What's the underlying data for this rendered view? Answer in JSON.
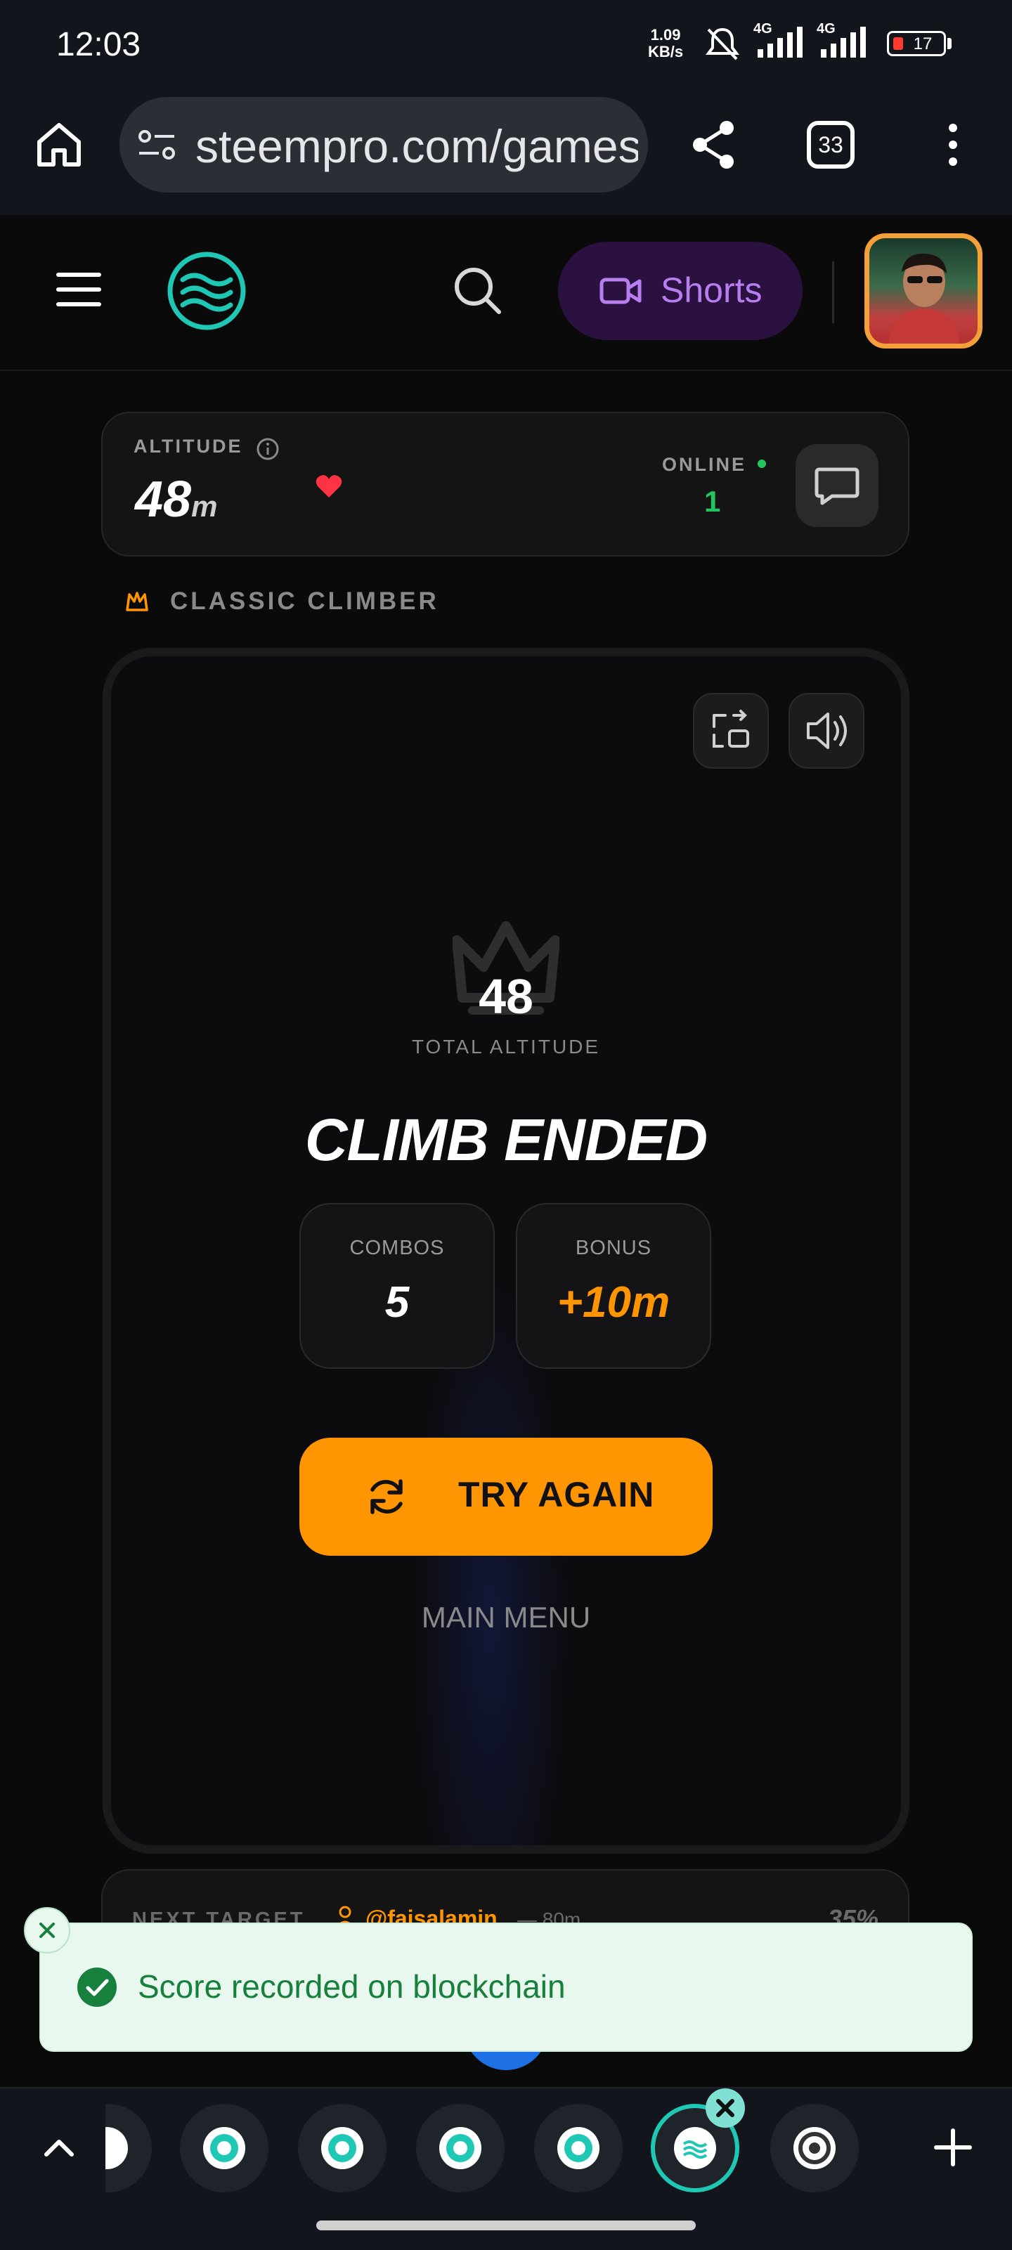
{
  "status_bar": {
    "time": "12:03",
    "net_speed_value": "1.09",
    "net_speed_unit": "KB/s",
    "network1": "4G",
    "network2": "4G",
    "battery": "17"
  },
  "browser": {
    "url": "steempro.com/games",
    "tab_count": "33"
  },
  "header": {
    "shorts_label": "Shorts"
  },
  "stats_bar": {
    "altitude_label": "ALTITUDE",
    "altitude_value": "48",
    "altitude_unit": "m",
    "online_label": "ONLINE",
    "online_count": "1"
  },
  "game": {
    "mode_title": "CLASSIC CLIMBER",
    "total_altitude_value": "48",
    "total_altitude_label": "TOTAL ALTITUDE",
    "result_title": "CLIMB ENDED",
    "combos_label": "COMBOS",
    "combos_value": "5",
    "bonus_label": "BONUS",
    "bonus_value": "+10m",
    "try_again_label": "TRY AGAIN",
    "main_menu_label": "MAIN MENU"
  },
  "next_target": {
    "label": "NEXT TARGET",
    "user": "@faisalamin",
    "distance": "— 80m",
    "percent": "35%"
  },
  "toast": {
    "message": "Score recorded on blockchain"
  },
  "colors": {
    "accent_orange": "#ff9500",
    "online_green": "#22c55e",
    "shorts_purple": "#b87ef0",
    "toast_bg": "#e8f8ee",
    "toast_text": "#17803d",
    "brand_teal": "#1ec8b4"
  },
  "icons": [
    "home-icon",
    "site-settings-icon",
    "share-icon",
    "more-icon",
    "menu-icon",
    "logo-icon",
    "search-icon",
    "video-icon",
    "info-icon",
    "heart-icon",
    "chat-icon",
    "crown-icon",
    "exit-fullscreen-icon",
    "sound-icon",
    "refresh-icon",
    "check-icon",
    "close-icon",
    "chevron-up-icon",
    "plus-icon"
  ]
}
